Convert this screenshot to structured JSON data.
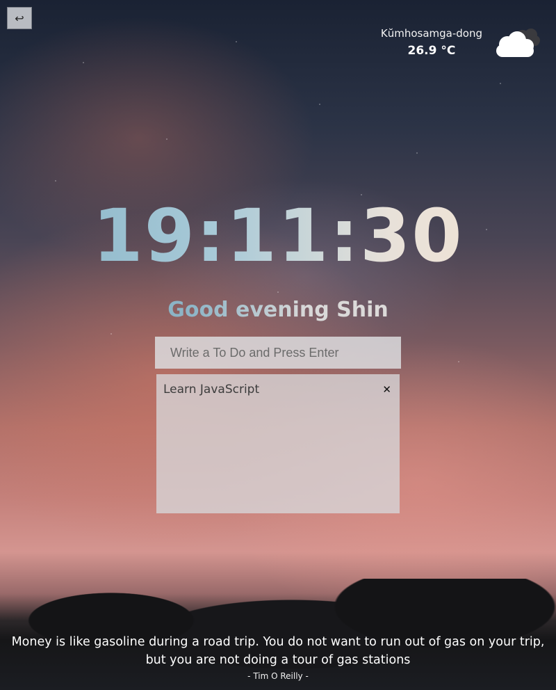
{
  "nav": {
    "back_icon": "return-arrow-icon",
    "back_glyph": "↩"
  },
  "weather": {
    "city": "Kŭmhosamga-dong",
    "temperature": "26.9 °C",
    "icon": "cloud-icon"
  },
  "clock": {
    "time": "19:11:30"
  },
  "greeting": {
    "text": "Good evening Shin"
  },
  "todo": {
    "input_placeholder": "Write a To Do and Press Enter",
    "input_value": "",
    "items": [
      {
        "text": "Learn JavaScript",
        "delete_glyph": "✕"
      }
    ]
  },
  "quote": {
    "text": "Money is like gasoline during a road trip. You do not want to run out of gas on your trip, but you are not doing a tour of gas stations",
    "author": "- Tim O Reilly -"
  },
  "colors": {
    "clock_gradient_start": "#86b3c6",
    "clock_gradient_end": "#f4e4d2",
    "panel_bg": "#d7d7da"
  }
}
